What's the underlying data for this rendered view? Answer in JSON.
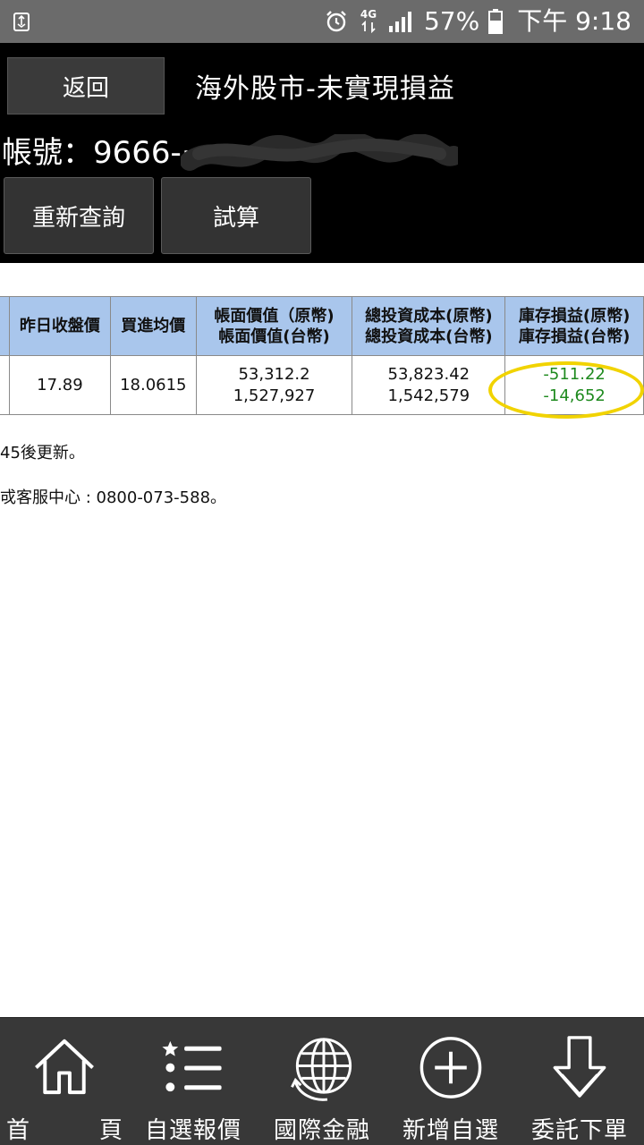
{
  "status_bar": {
    "network": "4G",
    "battery_percent": "57%",
    "time": "下午 9:18"
  },
  "header": {
    "back_label": "返回",
    "title": "海外股市-未實現損益",
    "account_label": "帳號：9666-·",
    "requery_label": "重新查詢",
    "calc_label": "試算"
  },
  "table": {
    "headers": [
      "昨日收盤價",
      "買進均價",
      [
        "帳面價值（原幣)",
        "帳面價值(台幣)"
      ],
      [
        "總投資成本(原幣)",
        "總投資成本(台幣)"
      ],
      [
        "庫存損益(原幣)",
        "庫存損益(台幣)"
      ]
    ],
    "rows": [
      {
        "prev_close": "17.89",
        "avg_buy": "18.0615",
        "book_value_orig": "53,312.2",
        "book_value_twd": "1,527,927",
        "total_cost_orig": "53,823.42",
        "total_cost_twd": "1,542,579",
        "pnl_orig": "-511.22",
        "pnl_twd": "-14,652"
      }
    ]
  },
  "notes": {
    "line1": "45後更新。",
    "line2": "戓客服中心 : 0800-073-588。"
  },
  "bottom_nav": [
    {
      "label": "首　頁",
      "icon": "home-icon"
    },
    {
      "label": "自選報價",
      "icon": "watchlist-icon"
    },
    {
      "label": "國際金融",
      "icon": "globe-icon"
    },
    {
      "label": "新增自選",
      "icon": "add-circle-icon"
    },
    {
      "label": "委託下單",
      "icon": "order-arrow-icon"
    }
  ],
  "colors": {
    "header_bg": "#000000",
    "table_header_bg": "#a9c6ec",
    "loss_green": "#1e8a1e",
    "highlight_yellow": "#f1d300",
    "nav_bg": "#383838"
  }
}
